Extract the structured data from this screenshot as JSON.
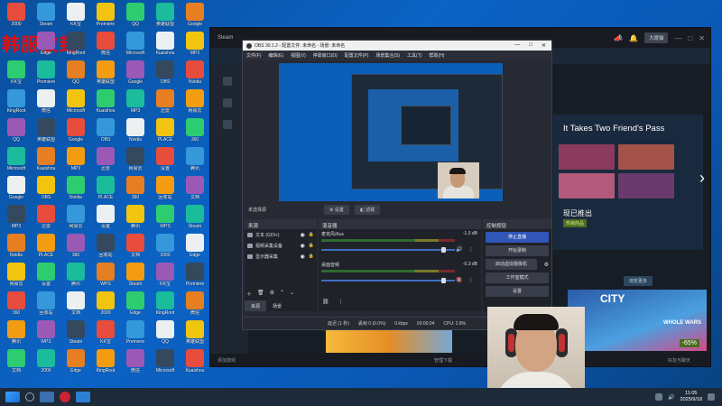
{
  "desktop": {
    "overlay_text": "韩服被封",
    "icons": [
      {
        "label": "2000"
      },
      {
        "label": "KK宝"
      },
      {
        "label": "KingRoot"
      },
      {
        "label": "QQ"
      },
      {
        "label": "Microsoft"
      },
      {
        "label": "Google"
      },
      {
        "label": "MP3"
      },
      {
        "label": "Nvidia"
      },
      {
        "label": "网易云"
      },
      {
        "label": "360"
      },
      {
        "label": "腾讯"
      },
      {
        "label": "文档"
      },
      {
        "label": "Steam"
      },
      {
        "label": "Edge"
      },
      {
        "label": "Premiere"
      },
      {
        "label": "微信"
      },
      {
        "label": "英雄联盟"
      },
      {
        "label": "Kuaishou"
      },
      {
        "label": "OBS"
      },
      {
        "label": "迅雷"
      },
      {
        "label": "PLACE"
      },
      {
        "label": "设置"
      },
      {
        "label": "回收站"
      },
      {
        "label": "WPS"
      }
    ]
  },
  "steam": {
    "title": "Steam",
    "account": "大眼猫",
    "feature_title": "It Takes Two Friend's Pass",
    "feature_sub": "现已推出",
    "feature_tag": "热销商品",
    "browse_label": "浏览更多",
    "city_text": "CITY",
    "city_sale": "WHOLE WARS",
    "city_off": "-65%",
    "status_left": "添加游戏",
    "status_mid": "管理下载",
    "status_right": "好友与聊天"
  },
  "obs": {
    "title": "OBS 30.1.2 - 配置文件: 未命名 - 场景: 未命名",
    "menu": [
      "文件(F)",
      "编辑(E)",
      "视图(V)",
      "停靠窗口(D)",
      "配置文件(P)",
      "场景集合(S)",
      "工具(T)",
      "帮助(H)"
    ],
    "no_source": "未选择源",
    "properties": "设置",
    "filters": "滤镜",
    "sources_title": "来源",
    "sources": [
      {
        "name": "文本 (GDI+)"
      },
      {
        "name": "视频采集设备"
      },
      {
        "name": "显示器采集"
      }
    ],
    "source_tabs": [
      "来源",
      "场景"
    ],
    "mixer_title": "混音器",
    "mixer": [
      {
        "name": "麦克风/Aux",
        "db": "-1.0 dB",
        "muted": false
      },
      {
        "name": "桌面音频",
        "db": "-0.3 dB",
        "muted": true
      }
    ],
    "controls_title": "控制按钮",
    "controls": [
      "停止直播",
      "开始录制",
      "启动虚拟摄像机",
      "工作室模式",
      "设置"
    ],
    "status": {
      "delay": "延迟 (1 秒)",
      "dropped": "丢帧 0 (0.0%)",
      "kbps": "0 kbps",
      "time": "00:00:04",
      "cpu": "CPU: 2.8%"
    }
  },
  "taskbar": {
    "time": "11:05",
    "date": "2025/9/18"
  }
}
